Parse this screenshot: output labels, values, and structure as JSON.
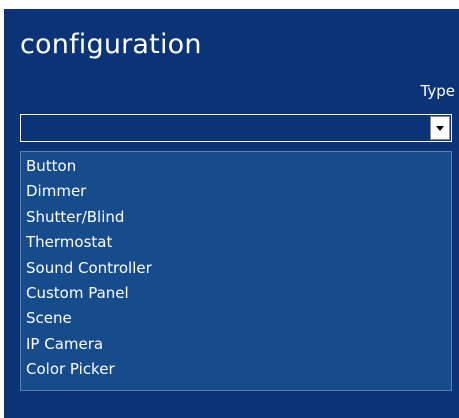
{
  "page": {
    "title": "configuration"
  },
  "field": {
    "label": "Type",
    "selected_value": ""
  },
  "dropdown": {
    "options": [
      "Button",
      "Dimmer",
      "Shutter/Blind",
      "Thermostat",
      "Sound Controller",
      "Custom Panel",
      "Scene",
      "IP Camera",
      "Color Picker"
    ]
  },
  "colors": {
    "panel_background": "#0b3478",
    "dropdown_background": "#174c8c",
    "text": "#ffffff"
  },
  "icons": {
    "dropdown_arrow": "chevron-down-icon"
  }
}
